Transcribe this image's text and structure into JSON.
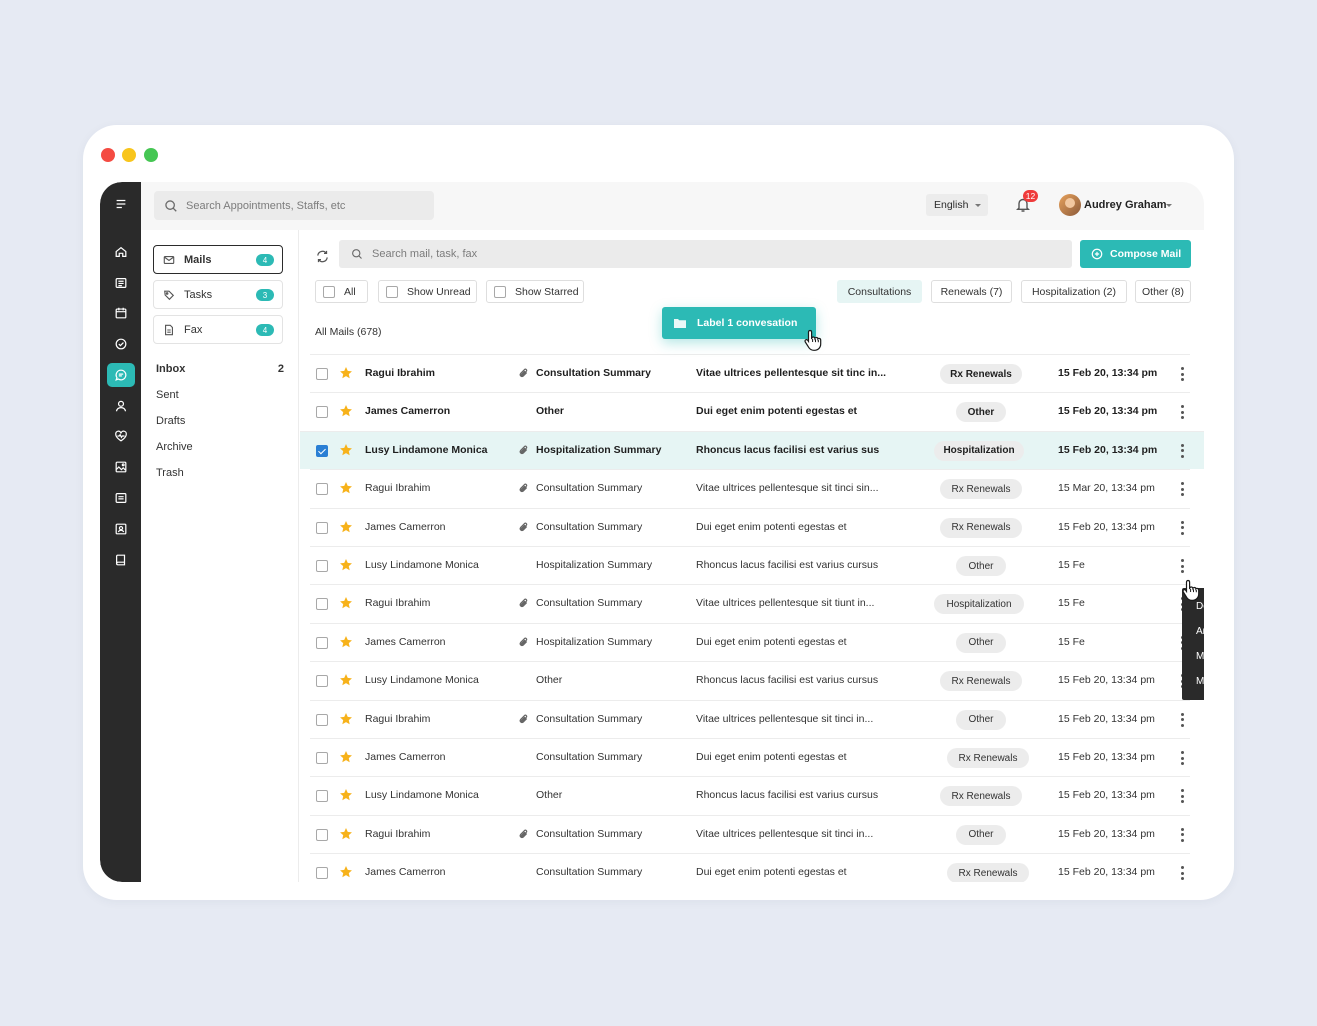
{
  "topbar": {
    "search_placeholder": "Search Appointments, Staffs, etc",
    "language": "English",
    "notifications_count": "12",
    "user_name": "Audrey Graham"
  },
  "rail": {
    "icons": [
      "menu-icon",
      "home-icon",
      "list-icon",
      "calendar-icon",
      "check-circle-icon",
      "chat-icon",
      "user-icon",
      "heart-pulse-icon",
      "image-icon",
      "message-square-icon",
      "contact-card-icon",
      "book-icon"
    ],
    "active_icon": "chat-icon"
  },
  "folders": {
    "tabs": [
      {
        "label": "Mails",
        "count": "4",
        "icon": "mail-icon"
      },
      {
        "label": "Tasks",
        "count": "3",
        "icon": "tag-icon"
      },
      {
        "label": "Fax",
        "count": "4",
        "icon": "document-icon"
      }
    ],
    "nav": [
      {
        "label": "Inbox",
        "count": "2"
      },
      {
        "label": "Sent",
        "count": ""
      },
      {
        "label": "Drafts",
        "count": ""
      },
      {
        "label": "Archive",
        "count": ""
      },
      {
        "label": "Trash",
        "count": ""
      }
    ]
  },
  "mail": {
    "search_placeholder": "Search mail, task, fax",
    "compose_label": "Compose Mail",
    "filters": [
      "All",
      "Show Unread",
      "Show Starred"
    ],
    "chips": [
      "Consultations",
      "Renewals (7)",
      "Hospitalization (2)",
      "Other (8)"
    ],
    "active_chip": "Consultations",
    "all_mails_label": "All Mails (678)",
    "label_toast": "Label 1 convesation",
    "rows": [
      {
        "sender": "Ragui Ibrahim",
        "attach": true,
        "subject": "Consultation Summary",
        "preview": "Vitae ultrices pellentesque sit tinc in...",
        "tag": "Rx Renewals",
        "date": "15 Feb 20, 13:34 pm",
        "bold": true,
        "checked": false
      },
      {
        "sender": "James Camerron",
        "attach": false,
        "subject": "Other",
        "preview": "Dui eget enim potenti egestas et",
        "tag": "Other",
        "date": "15 Feb 20, 13:34 pm",
        "bold": true,
        "checked": false
      },
      {
        "sender": "Lusy Lindamone Monica",
        "attach": true,
        "subject": "Hospitalization Summary",
        "preview": "Rhoncus lacus facilisi est varius sus",
        "tag": "Hospitalization",
        "date": "15 Feb 20, 13:34 pm",
        "bold": true,
        "checked": true
      },
      {
        "sender": "Ragui Ibrahim",
        "attach": true,
        "subject": "Consultation Summary",
        "preview": "Vitae ultrices pellentesque sit tinci sin...",
        "tag": "Rx Renewals",
        "date": "15 Mar 20, 13:34 pm",
        "bold": false,
        "checked": false
      },
      {
        "sender": "James Camerron",
        "attach": true,
        "subject": "Consultation Summary",
        "preview": "Dui eget enim potenti egestas et",
        "tag": "Rx Renewals",
        "date": "15 Feb 20, 13:34 pm",
        "bold": false,
        "checked": false
      },
      {
        "sender": "Lusy Lindamone Monica",
        "attach": false,
        "subject": "Hospitalization Summary",
        "preview": "Rhoncus lacus facilisi est varius cursus",
        "tag": "Other",
        "date": "15 Fe",
        "bold": false,
        "checked": false
      },
      {
        "sender": "Ragui Ibrahim",
        "attach": true,
        "subject": "Consultation Summary",
        "preview": "Vitae ultrices pellentesque sit tiunt in...",
        "tag": "Hospitalization",
        "date": "15 Fe",
        "bold": false,
        "checked": false
      },
      {
        "sender": "James Camerron",
        "attach": true,
        "subject": "Hospitalization Summary",
        "preview": "Dui eget enim potenti egestas et",
        "tag": "Other",
        "date": "15 Fe",
        "bold": false,
        "checked": false
      },
      {
        "sender": "Lusy Lindamone Monica",
        "attach": false,
        "subject": "Other",
        "preview": "Rhoncus lacus facilisi est varius cursus",
        "tag": "Rx Renewals",
        "date": "15 Feb 20, 13:34 pm",
        "bold": false,
        "checked": false
      },
      {
        "sender": "Ragui Ibrahim",
        "attach": true,
        "subject": "Consultation Summary",
        "preview": "Vitae ultrices pellentesque sit tinci in...",
        "tag": "Other",
        "date": "15 Feb 20, 13:34 pm",
        "bold": false,
        "checked": false
      },
      {
        "sender": "James Camerron",
        "attach": false,
        "subject": "Consultation Summary",
        "preview": "Dui eget enim potenti egestas et",
        "tag": "Rx Renewals",
        "date": "15 Feb 20, 13:34 pm",
        "bold": false,
        "checked": false
      },
      {
        "sender": "Lusy Lindamone Monica",
        "attach": false,
        "subject": "Other",
        "preview": "Rhoncus lacus facilisi est varius cursus",
        "tag": "Rx Renewals",
        "date": "15 Feb 20, 13:34 pm",
        "bold": false,
        "checked": false
      },
      {
        "sender": "Ragui Ibrahim",
        "attach": true,
        "subject": "Consultation Summary",
        "preview": "Vitae ultrices pellentesque sit tinci in...",
        "tag": "Other",
        "date": "15 Feb 20, 13:34 pm",
        "bold": false,
        "checked": false
      },
      {
        "sender": "James Camerron",
        "attach": false,
        "subject": "Consultation Summary",
        "preview": "Dui eget enim potenti egestas et",
        "tag": "Rx Renewals",
        "date": "15 Feb 20, 13:34 pm",
        "bold": false,
        "checked": false
      }
    ],
    "context_menu": [
      "Delete",
      "Archieve",
      "Mark as read",
      "Mark as unread"
    ]
  },
  "colors": {
    "accent": "#2cbab5",
    "rail": "#2a2a2a",
    "star": "#f7b21a",
    "badge": "#ef3b3b",
    "checkbox_checked": "#2a7fd4"
  }
}
